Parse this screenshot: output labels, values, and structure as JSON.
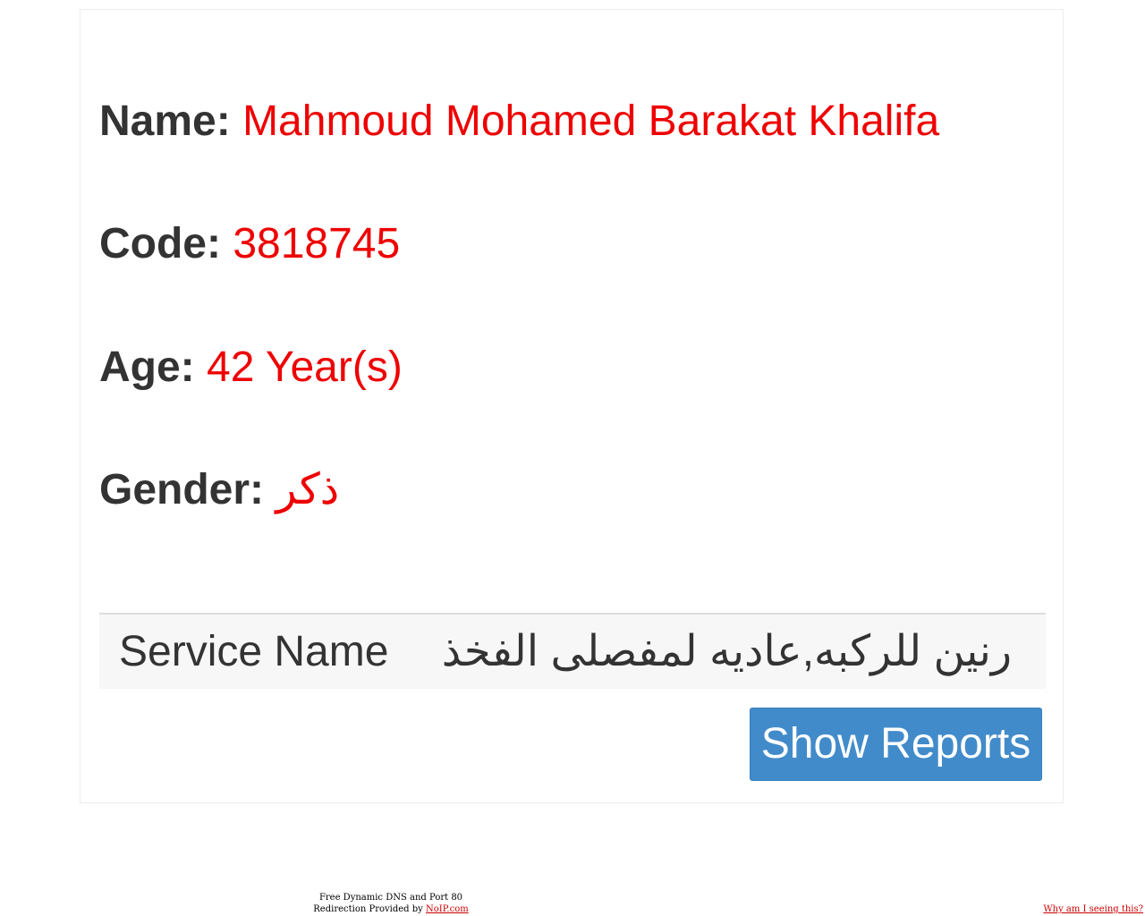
{
  "patient": {
    "name_label": "Name:",
    "name_value": "Mahmoud Mohamed Barakat Khalifa",
    "code_label": "Code:",
    "code_value": "3818745",
    "age_label": "Age:",
    "age_value": "42 Year(s)",
    "gender_label": "Gender:",
    "gender_value": "ذكر"
  },
  "service": {
    "label": "Service Name",
    "value": "رنين للركبه,عاديه لمفصلى الفخذ"
  },
  "actions": {
    "show_reports_label": "Show Reports"
  },
  "footer": {
    "line1": "Free Dynamic DNS and Port 80",
    "line2_prefix": "Redirection Provided by",
    "noip_link": "NoIP.com",
    "why_link": "Why am I seeing this?"
  },
  "colors": {
    "value_text": "#ee0000",
    "button_bg": "#428bca",
    "service_row_bg": "#f7f7f7"
  }
}
